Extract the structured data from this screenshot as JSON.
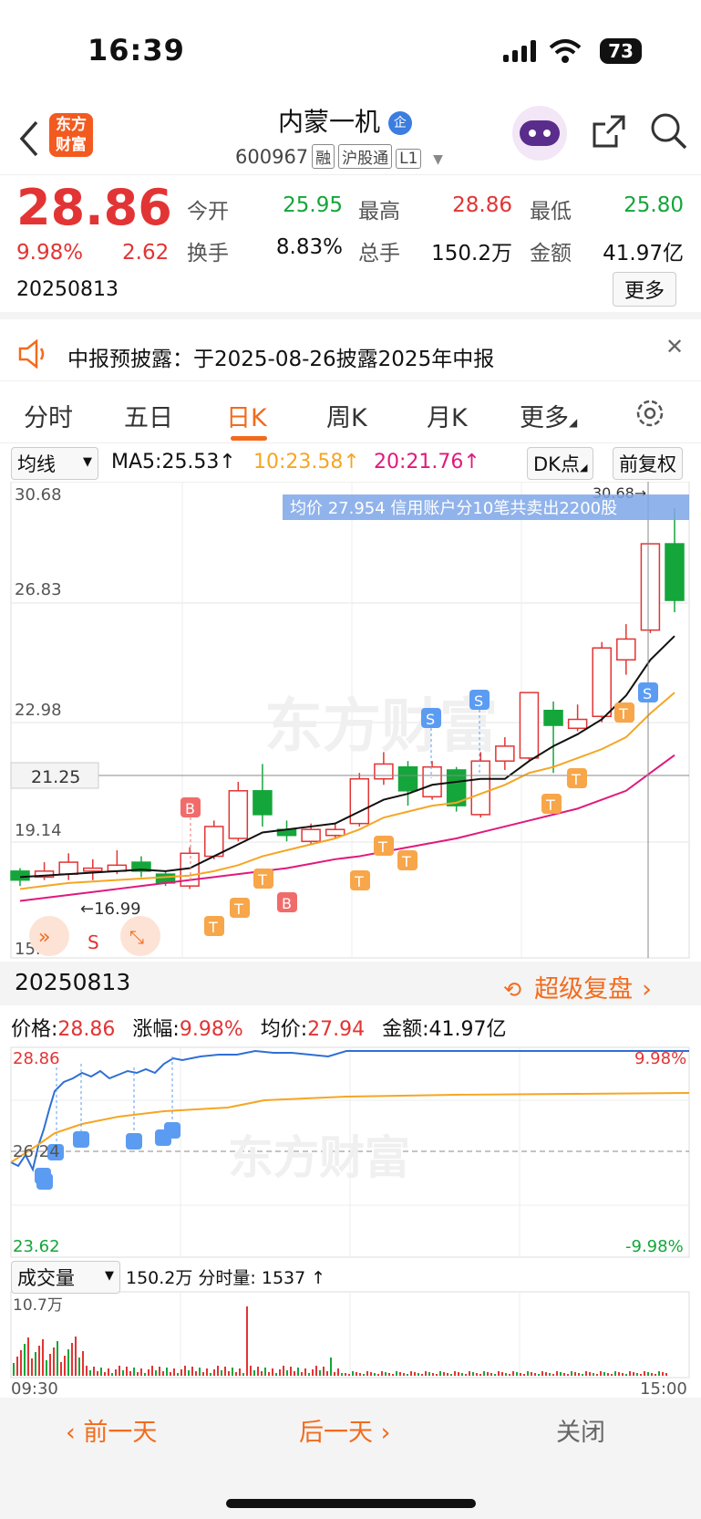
{
  "status": {
    "time": "16:39",
    "battery": "73"
  },
  "header": {
    "logo_line1": "东方",
    "logo_line2": "财富",
    "name": "内蒙一机",
    "name_badge": "企",
    "code": "600967",
    "tags": [
      "融",
      "沪股通",
      "L1"
    ]
  },
  "quote": {
    "price": "28.86",
    "change_pct": "9.98%",
    "change": "2.62",
    "date": "20250813",
    "open_label": "今开",
    "open": "25.95",
    "high_label": "最高",
    "high": "28.86",
    "low_label": "最低",
    "low": "25.80",
    "turnover_label": "换手",
    "turnover": "8.83%",
    "volume_label": "总手",
    "volume": "150.2万",
    "amount_label": "金额",
    "amount": "41.97亿",
    "more": "更多"
  },
  "notice": {
    "text": "中报预披露：于2025-08-26披露2025年中报"
  },
  "tabs": [
    "分时",
    "五日",
    "日K",
    "周K",
    "月K",
    "更多"
  ],
  "ma": {
    "selector": "均线",
    "ma5": "MA5:25.53↑",
    "ma10": "10:23.58↑",
    "ma20": "20:21.76↑",
    "dk": "DK点",
    "adjust": "前复权"
  },
  "kchart": {
    "y_labels": [
      "30.68",
      "26.83",
      "22.98",
      "19.14",
      "15.29"
    ],
    "crosshair_label": "21.25",
    "high_marker": "30.68→",
    "low_marker": "←16.99",
    "tooltip": "均价 27.954 信用账户分10笔共卖出2200股",
    "watermark": "东方财富",
    "s_label": "S"
  },
  "chart_data": {
    "type": "candlestick",
    "ylim": [
      15.29,
      30.68
    ],
    "candles": [
      {
        "o": 17.9,
        "c": 17.6,
        "h": 18.0,
        "l": 17.4
      },
      {
        "o": 17.7,
        "c": 17.9,
        "h": 18.2,
        "l": 17.6
      },
      {
        "o": 17.8,
        "c": 18.2,
        "h": 18.5,
        "l": 17.6
      },
      {
        "o": 17.9,
        "c": 18.0,
        "h": 18.3,
        "l": 17.6
      },
      {
        "o": 17.9,
        "c": 18.1,
        "h": 18.6,
        "l": 17.8
      },
      {
        "o": 18.2,
        "c": 17.9,
        "h": 18.4,
        "l": 17.7
      },
      {
        "o": 17.8,
        "c": 17.5,
        "h": 17.9,
        "l": 17.4
      },
      {
        "o": 17.4,
        "c": 18.5,
        "h": 18.7,
        "l": 17.3
      },
      {
        "o": 18.4,
        "c": 19.4,
        "h": 19.6,
        "l": 18.3
      },
      {
        "o": 19.0,
        "c": 20.6,
        "h": 20.9,
        "l": 18.9
      },
      {
        "o": 20.6,
        "c": 19.8,
        "h": 21.5,
        "l": 19.4
      },
      {
        "o": 19.3,
        "c": 19.1,
        "h": 19.6,
        "l": 18.9
      },
      {
        "o": 18.9,
        "c": 19.3,
        "h": 19.5,
        "l": 18.8
      },
      {
        "o": 19.1,
        "c": 19.3,
        "h": 19.5,
        "l": 19.0
      },
      {
        "o": 19.5,
        "c": 21.0,
        "h": 21.2,
        "l": 19.4
      },
      {
        "o": 21.0,
        "c": 21.5,
        "h": 21.9,
        "l": 20.8
      },
      {
        "o": 21.4,
        "c": 20.6,
        "h": 21.6,
        "l": 20.1
      },
      {
        "o": 20.4,
        "c": 21.4,
        "h": 21.6,
        "l": 20.3
      },
      {
        "o": 21.3,
        "c": 20.1,
        "h": 21.4,
        "l": 19.9
      },
      {
        "o": 19.8,
        "c": 21.6,
        "h": 21.9,
        "l": 19.7
      },
      {
        "o": 21.6,
        "c": 22.1,
        "h": 22.4,
        "l": 21.3
      },
      {
        "o": 21.7,
        "c": 23.9,
        "h": 23.9,
        "l": 21.6
      },
      {
        "o": 23.3,
        "c": 22.8,
        "h": 23.6,
        "l": 21.2
      },
      {
        "o": 22.7,
        "c": 23.0,
        "h": 23.5,
        "l": 22.6
      },
      {
        "o": 23.1,
        "c": 25.4,
        "h": 25.6,
        "l": 22.9
      },
      {
        "o": 25.0,
        "c": 25.7,
        "h": 26.2,
        "l": 24.5
      },
      {
        "o": 26.0,
        "c": 28.9,
        "h": 28.9,
        "l": 25.9
      },
      {
        "o": 28.9,
        "c": 27.0,
        "h": 30.1,
        "l": 26.6
      }
    ],
    "ma5": [
      17.7,
      17.75,
      17.8,
      17.85,
      17.9,
      17.95,
      17.9,
      18.0,
      18.4,
      18.8,
      19.2,
      19.3,
      19.4,
      19.5,
      19.9,
      20.3,
      20.5,
      20.8,
      20.9,
      21.0,
      21.0,
      21.6,
      22.1,
      22.5,
      23.0,
      23.8,
      25.0,
      25.8
    ],
    "ma10": [
      17.3,
      17.4,
      17.5,
      17.55,
      17.6,
      17.65,
      17.7,
      17.75,
      17.9,
      18.1,
      18.4,
      18.6,
      18.8,
      19.0,
      19.3,
      19.7,
      19.9,
      20.1,
      20.2,
      20.5,
      20.8,
      21.2,
      21.4,
      21.7,
      22.0,
      22.4,
      23.2,
      23.9
    ],
    "ma20": [
      16.9,
      17.0,
      17.1,
      17.2,
      17.3,
      17.4,
      17.5,
      17.6,
      17.7,
      17.8,
      17.9,
      18.0,
      18.15,
      18.3,
      18.4,
      18.55,
      18.7,
      18.85,
      19.0,
      19.2,
      19.4,
      19.6,
      19.8,
      20.0,
      20.3,
      20.6,
      21.2,
      21.8
    ]
  },
  "intraday": {
    "date": "20250813",
    "review": "超级复盘",
    "price_label": "价格:",
    "price": "28.86",
    "change_label": "涨幅:",
    "change": "9.98%",
    "avg_label": "均价:",
    "avg": "27.94",
    "amount_label": "金额:",
    "amount": "41.97亿",
    "y_top": "28.86",
    "y_mid": "26.24",
    "y_bottom": "23.62",
    "pct_top": "9.98%",
    "pct_bottom": "-9.98%",
    "vol_selector": "成交量",
    "vol_summary": "150.2万 分时量: 1537 ↑",
    "vol_max": "10.7万",
    "time_start": "09:30",
    "time_end": "15:00"
  },
  "footer": {
    "prev": "前一天",
    "next": "后一天",
    "close": "关闭"
  }
}
